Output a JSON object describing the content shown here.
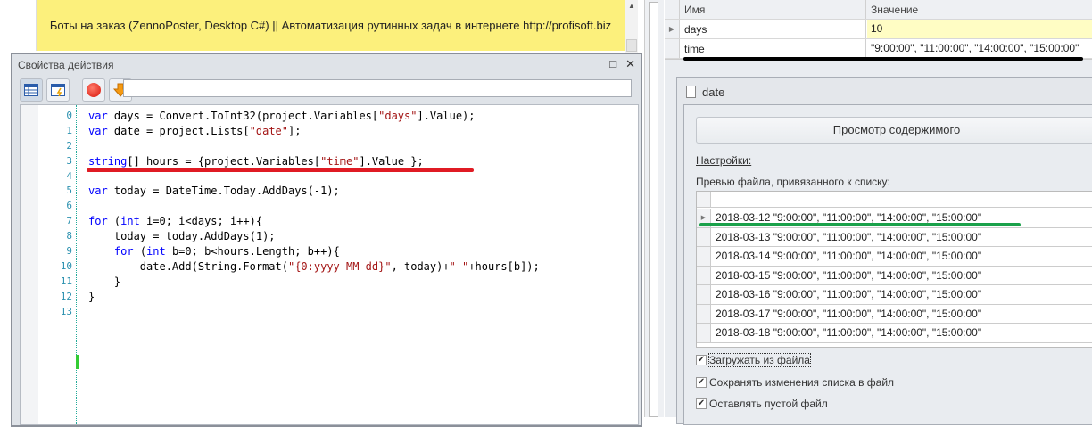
{
  "banner": {
    "text": "Боты на заказ (ZennoPoster, Desktop C#) || Автоматизация рутинных задач в интернете http://profisoft.biz"
  },
  "dialog": {
    "title": "Свойства действия",
    "maximize_icon": "□",
    "close_icon": "✕"
  },
  "code": {
    "lines": [
      [
        {
          "t": "var",
          "c": "kw"
        },
        {
          "t": " days = Convert.ToInt32(project.Variables[",
          "c": "pl"
        },
        {
          "t": "\"days\"",
          "c": "st"
        },
        {
          "t": "].Value);",
          "c": "pl"
        }
      ],
      [
        {
          "t": "var",
          "c": "kw"
        },
        {
          "t": " date = project.Lists[",
          "c": "pl"
        },
        {
          "t": "\"date\"",
          "c": "st"
        },
        {
          "t": "];",
          "c": "pl"
        }
      ],
      [],
      [
        {
          "t": "string",
          "c": "kw"
        },
        {
          "t": "[] hours = {project.Variables[",
          "c": "pl"
        },
        {
          "t": "\"time\"",
          "c": "st"
        },
        {
          "t": "].Value };",
          "c": "pl"
        }
      ],
      [],
      [
        {
          "t": "var",
          "c": "kw"
        },
        {
          "t": " today = DateTime.Today.AddDays(-1);",
          "c": "pl"
        }
      ],
      [],
      [
        {
          "t": "for",
          "c": "kw"
        },
        {
          "t": " (",
          "c": "pl"
        },
        {
          "t": "int",
          "c": "kw"
        },
        {
          "t": " i=0; i<days; i++){",
          "c": "pl"
        }
      ],
      [
        {
          "t": "    today = today.AddDays(1);",
          "c": "pl"
        }
      ],
      [
        {
          "t": "    ",
          "c": "pl"
        },
        {
          "t": "for",
          "c": "kw"
        },
        {
          "t": " (",
          "c": "pl"
        },
        {
          "t": "int",
          "c": "kw"
        },
        {
          "t": " b=0; b<hours.Length; b++){",
          "c": "pl"
        }
      ],
      [
        {
          "t": "        date.Add(String.Format(",
          "c": "pl"
        },
        {
          "t": "\"{0:yyyy-MM-dd}\"",
          "c": "st"
        },
        {
          "t": ", today)+",
          "c": "pl"
        },
        {
          "t": "\" \"",
          "c": "st"
        },
        {
          "t": "+hours[b]);",
          "c": "pl"
        }
      ],
      [
        {
          "t": "    }",
          "c": "pl"
        }
      ],
      [
        {
          "t": "}",
          "c": "pl"
        }
      ],
      []
    ]
  },
  "variables": {
    "headers": [
      "Имя",
      "Значение"
    ],
    "rows": [
      {
        "name": "days",
        "value": "10"
      },
      {
        "name": "time",
        "value": "\"9:00:00\", \"11:00:00\", \"14:00:00\", \"15:00:00\""
      }
    ]
  },
  "list": {
    "name": "date",
    "view_button": "Просмотр содержимого",
    "settings_label": "Настройки:",
    "preview_label": "Превью файла, привязанного к списку:",
    "preview_rows": [
      "2018-03-12 \"9:00:00\", \"11:00:00\", \"14:00:00\", \"15:00:00\"",
      "2018-03-13 \"9:00:00\", \"11:00:00\", \"14:00:00\", \"15:00:00\"",
      "2018-03-14 \"9:00:00\", \"11:00:00\", \"14:00:00\", \"15:00:00\"",
      "2018-03-15 \"9:00:00\", \"11:00:00\", \"14:00:00\", \"15:00:00\"",
      "2018-03-16 \"9:00:00\", \"11:00:00\", \"14:00:00\", \"15:00:00\"",
      "2018-03-17 \"9:00:00\", \"11:00:00\", \"14:00:00\", \"15:00:00\"",
      "2018-03-18 \"9:00:00\", \"11:00:00\", \"14:00:00\", \"15:00:00\""
    ],
    "checkboxes": [
      {
        "label": "Загружать из файла",
        "checked": true
      },
      {
        "label": "Сохранять изменения списка в файл",
        "checked": true
      },
      {
        "label": "Оставлять пустой файл",
        "checked": true
      }
    ]
  }
}
